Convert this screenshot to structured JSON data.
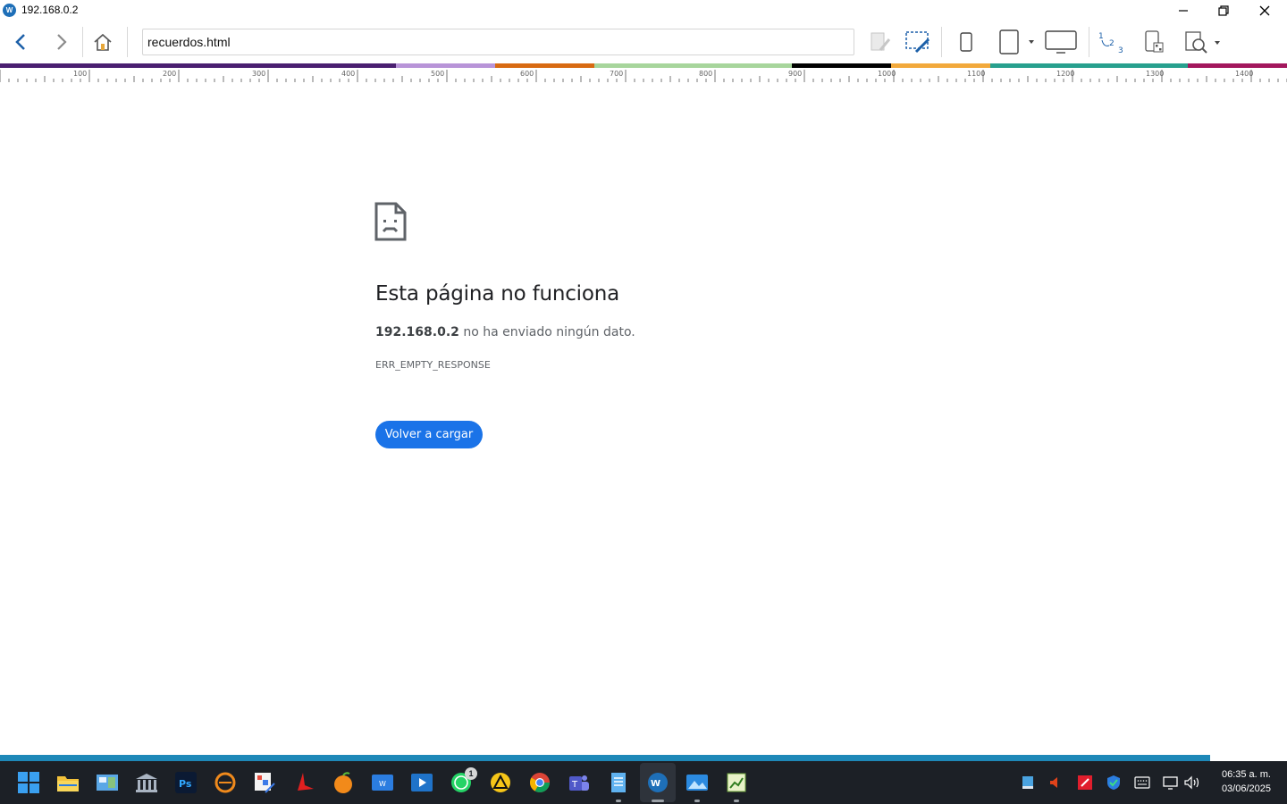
{
  "window": {
    "title": "192.168.0.2",
    "logo_text": "W"
  },
  "toolbar": {
    "address_value": "recuerdos.html"
  },
  "ruler": {
    "labels": [
      "100",
      "200",
      "300",
      "400",
      "500",
      "600",
      "700",
      "800",
      "900",
      "1000",
      "1100",
      "1200",
      "1300",
      "1400"
    ],
    "band_colors": [
      "#4a1f70",
      "#4a1f70",
      "#4a1f70",
      "#4a1f70",
      "#b894d8",
      "#d86a12",
      "#a7d59c",
      "#a7d59c",
      "#000000",
      "#f2a93b",
      "#27a08e",
      "#27a08e",
      "#a3175d"
    ]
  },
  "error": {
    "title": "Esta página no funciona",
    "host": "192.168.0.2",
    "message": " no ha enviado ningún dato.",
    "code": "ERR_EMPTY_RESPONSE",
    "reload_label": "Volver a cargar"
  },
  "progress": {
    "fraction": 0.94
  },
  "taskbar": {
    "whatsapp_badge": "1",
    "clock_time": "06:35 a. m.",
    "clock_date": "03/06/2025",
    "accent": "#1a73e8"
  }
}
